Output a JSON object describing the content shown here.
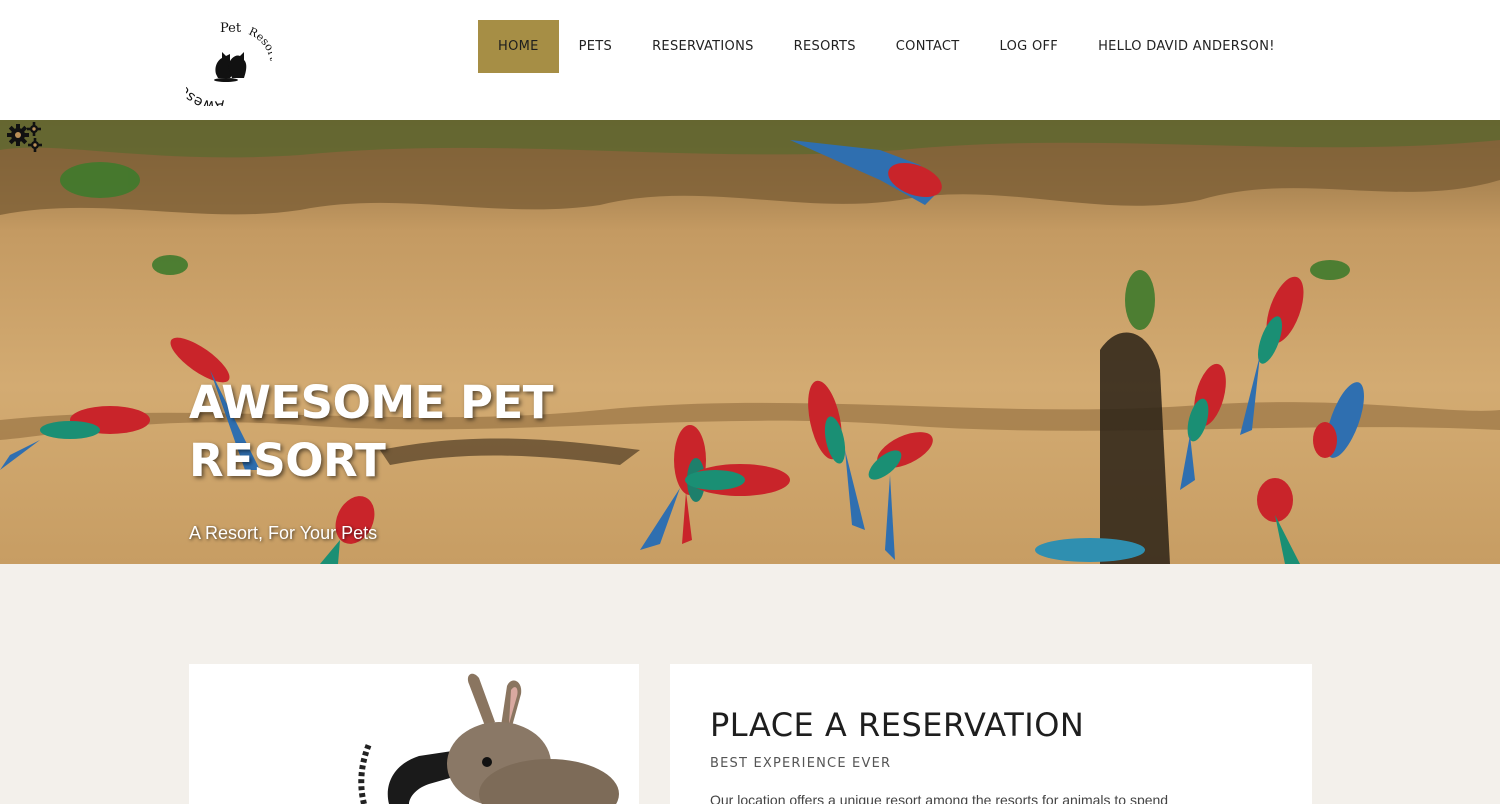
{
  "logo": {
    "line1": "Awesome",
    "line2": "Pet",
    "line3": "Resort"
  },
  "nav": {
    "items": [
      {
        "label": "HOME",
        "active": true
      },
      {
        "label": "PETS"
      },
      {
        "label": "RESERVATIONS"
      },
      {
        "label": "RESORTS"
      },
      {
        "label": "CONTACT"
      },
      {
        "label": "LOG OFF"
      },
      {
        "label": "HELLO DAVID ANDERSON!"
      }
    ]
  },
  "hero": {
    "title": "AWESOME PET RESORT",
    "subtitle": "A Resort, For Your Pets"
  },
  "reservation": {
    "title": "PLACE A RESERVATION",
    "subtitle": "BEST EXPERIENCE EVER",
    "body": "Our location offers a unique resort among the resorts for animals to spend"
  },
  "colors": {
    "accent": "#a68e45",
    "page_bg": "#f3f0eb"
  }
}
